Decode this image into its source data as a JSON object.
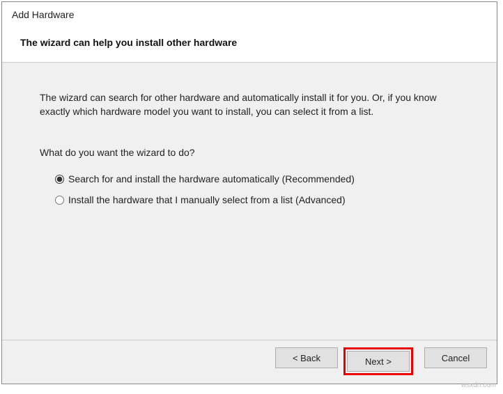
{
  "header": {
    "title": "Add Hardware",
    "subtitle": "The wizard can help you install other hardware"
  },
  "content": {
    "intro": "The wizard can search for other hardware and automatically install it for you. Or, if you know exactly which hardware model you want to install, you can select it from a list.",
    "question": "What do you want the wizard to do?",
    "options": {
      "search": "Search for and install the hardware automatically (Recommended)",
      "manual": "Install the hardware that I manually select from a list (Advanced)"
    }
  },
  "footer": {
    "back": "< Back",
    "next": "Next >",
    "cancel": "Cancel"
  },
  "watermark": "wsxdn.com"
}
